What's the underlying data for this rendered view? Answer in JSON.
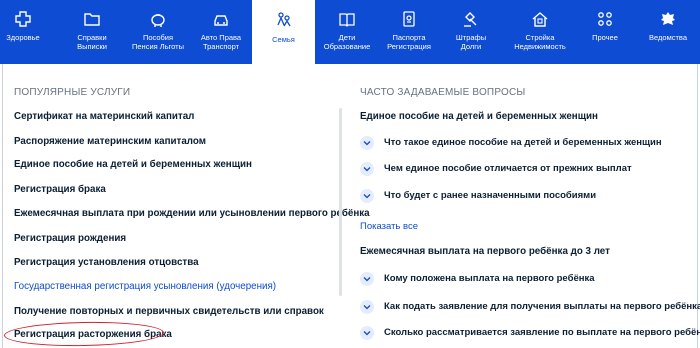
{
  "nav": {
    "items": [
      {
        "label": "Здоровье",
        "icon": "plus-icon"
      },
      {
        "label": "Справки\nВыписки",
        "icon": "folder-icon"
      },
      {
        "label": "Пособия\nПенсия Льготы",
        "icon": "piggy-bank-icon"
      },
      {
        "label": "Авто Права\nТранспорт",
        "icon": "car-icon"
      },
      {
        "label": "Семья",
        "icon": "family-icon",
        "active": true
      },
      {
        "label": "Дети\nОбразование",
        "icon": "book-icon"
      },
      {
        "label": "Паспорта\nРегистрация",
        "icon": "passport-icon"
      },
      {
        "label": "Штрафы\nДолги",
        "icon": "gavel-icon"
      },
      {
        "label": "Стройка\nНедвижимость",
        "icon": "house-icon"
      },
      {
        "label": "Прочее",
        "icon": "grid-icon"
      },
      {
        "label": "Ведомства",
        "icon": "emblem-icon"
      }
    ]
  },
  "popular": {
    "title": "ПОПУЛЯРНЫЕ УСЛУГИ",
    "items": [
      "Сертификат на материнский капитал",
      "Распоряжение материнским капиталом",
      "Единое пособие на детей и беременных женщин",
      "Регистрация брака",
      "Ежемесячная выплата при рождении или усыновлении первого ребёнка",
      "Регистрация рождения",
      "Регистрация установления отцовства",
      "Государственная регистрация усыновления (удочерения)",
      "Получение повторных и первичных свидетельств или справок",
      "Регистрация расторжения брака"
    ]
  },
  "faq": {
    "title": "ЧАСТО ЗАДАВАЕМЫЕ ВОПРОСЫ",
    "group1": {
      "heading": "Единое пособие на детей и беременных женщин",
      "questions": [
        "Что такое единое пособие на детей и беременных женщин",
        "Чем единое пособие отличается от прежних выплат",
        "Что будет с ранее назначенными пособиями"
      ]
    },
    "show_all": "Показать все",
    "group2": {
      "heading": "Ежемесячная выплата на первого ребёнка до 3 лет",
      "questions": [
        "Кому положена выплата на первого ребёнка",
        "Как подать заявление для получения выплаты на первого ребёнка",
        "Сколько рассматривается заявление по выплате на первого ребёнка"
      ]
    }
  },
  "colors": {
    "nav_bg": "#0d4cd3",
    "accent_link": "#0d4cd3",
    "highlight_circle": "#d2202f"
  }
}
